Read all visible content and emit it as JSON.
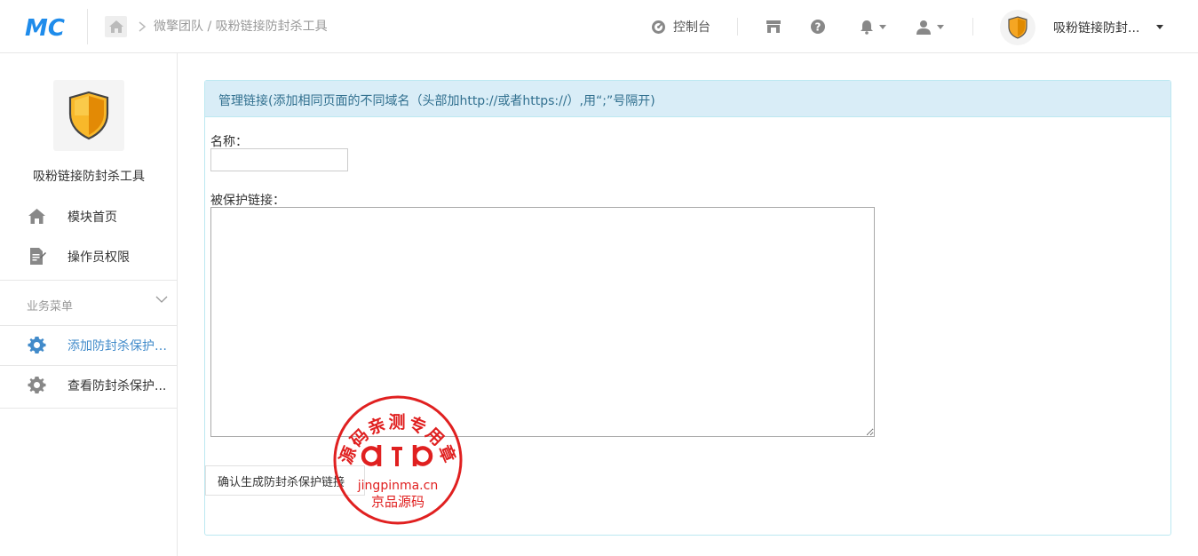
{
  "header": {
    "logo_text": "MC",
    "breadcrumb": [
      "微擎团队",
      "吸粉链接防封杀工具"
    ],
    "console_label": "控制台",
    "user_name": "吸粉链接防封..."
  },
  "sidebar": {
    "module_title": "吸粉链接防封杀工具",
    "items": [
      {
        "label": "模块首页"
      },
      {
        "label": "操作员权限"
      }
    ],
    "section_title": "业务菜单",
    "business_items": [
      {
        "label": "添加防封杀保护链..."
      },
      {
        "label": "查看防封杀保护..."
      }
    ]
  },
  "panel": {
    "heading": "管理链接(添加相同页面的不同域名（头部加http://或者https://）,用“;”号隔开)",
    "name_label": "名称：",
    "name_value": "",
    "links_label": "被保护链接：",
    "links_value": "",
    "submit_label": "确认生成防封杀保护链接"
  },
  "seal": {
    "arc_text": "源码亲测专用章",
    "domain": "jingpinma.cn",
    "brand": "京品源码",
    "color": "#e02020"
  },
  "colors": {
    "accent": "#428bca",
    "panel_head_bg": "#d9edf7",
    "panel_head_text": "#31708f",
    "panel_border": "#bce8f1"
  }
}
